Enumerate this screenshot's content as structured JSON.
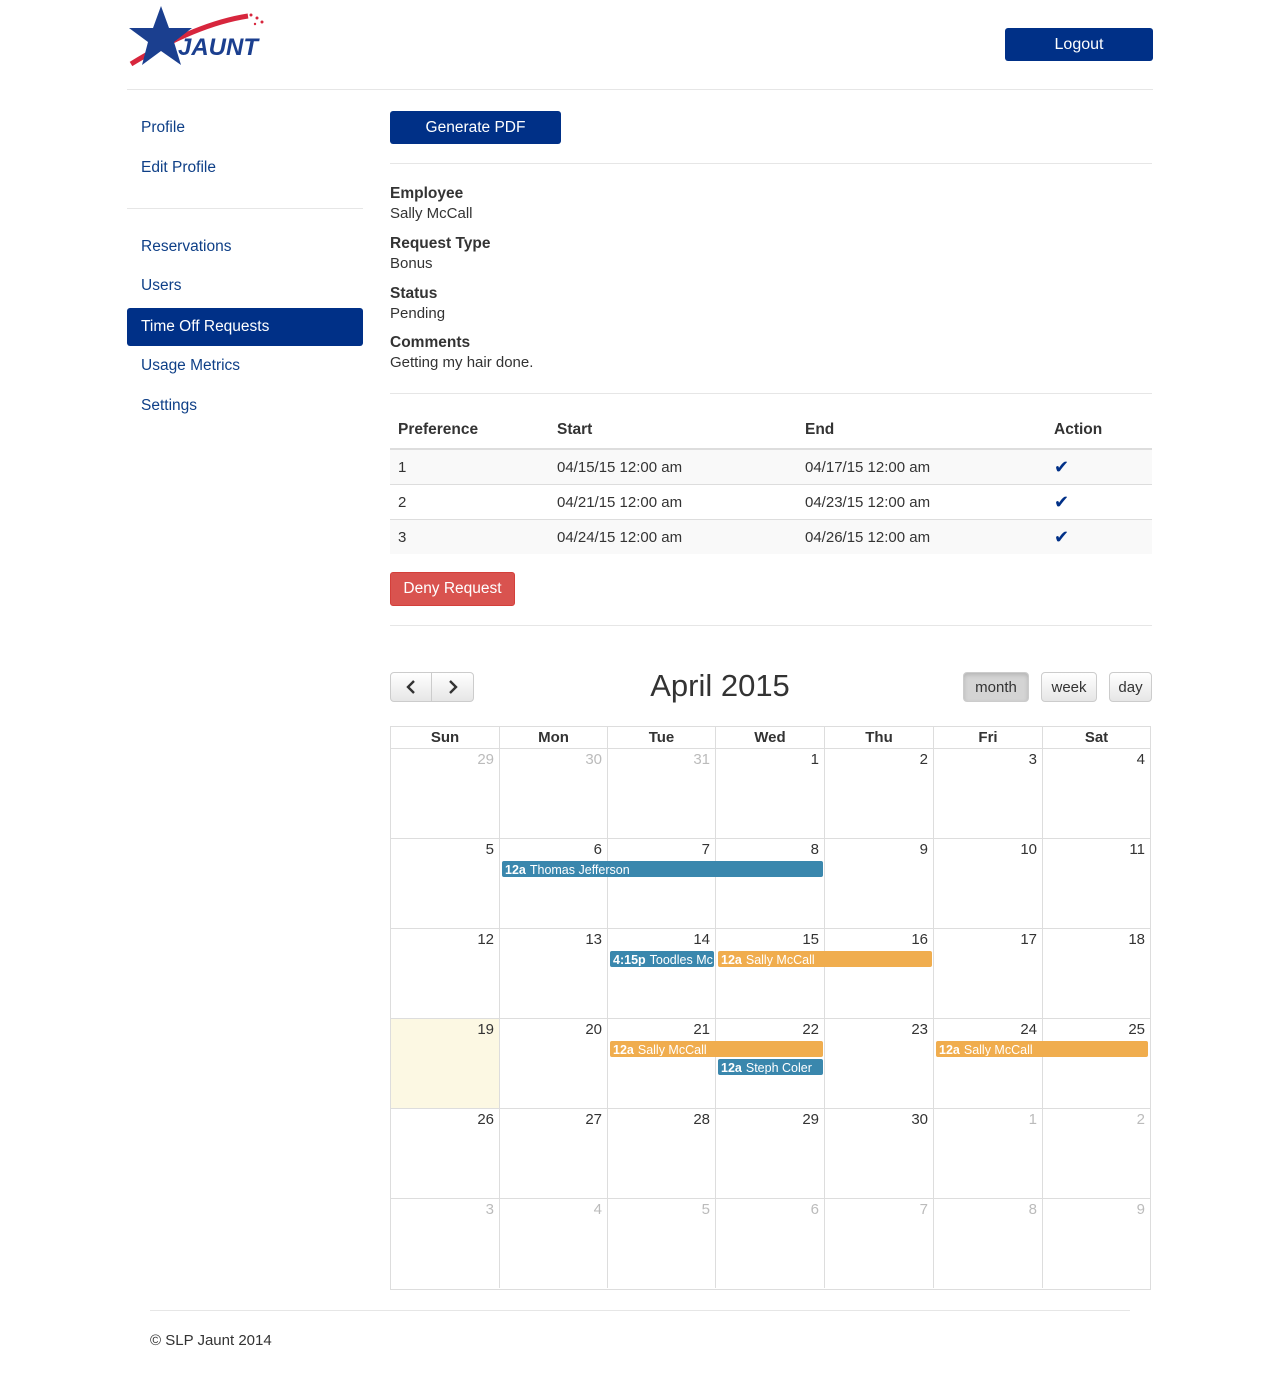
{
  "header": {
    "logo_text": "JAUNT",
    "logout_label": "Logout"
  },
  "colors": {
    "brand": "#003087",
    "danger": "#d9534f",
    "event_blue": "#3a87ad",
    "event_orange": "#f0ad4e",
    "today": "#fcf8e3"
  },
  "sidebar": {
    "group1": [
      "Profile",
      "Edit Profile"
    ],
    "group2": [
      "Reservations",
      "Users",
      "Time Off Requests",
      "Usage Metrics",
      "Settings"
    ],
    "active": "Time Off Requests"
  },
  "main": {
    "generate_pdf_label": "Generate PDF",
    "fields": [
      {
        "label": "Employee",
        "value": "Sally McCall"
      },
      {
        "label": "Request Type",
        "value": "Bonus"
      },
      {
        "label": "Status",
        "value": "Pending"
      },
      {
        "label": "Comments",
        "value": "Getting my hair done."
      }
    ],
    "table": {
      "headers": [
        "Preference",
        "Start",
        "End",
        "Action"
      ],
      "rows": [
        [
          "1",
          "04/15/15 12:00 am",
          "04/17/15 12:00 am",
          "check-icon"
        ],
        [
          "2",
          "04/21/15 12:00 am",
          "04/23/15 12:00 am",
          "check-icon"
        ],
        [
          "3",
          "04/24/15 12:00 am",
          "04/26/15 12:00 am",
          "check-icon"
        ]
      ]
    },
    "deny_label": "Deny Request"
  },
  "calendar": {
    "title": "April 2015",
    "prev_icon": "chevron-left-icon",
    "next_icon": "chevron-right-icon",
    "views": [
      "month",
      "week",
      "day"
    ],
    "active_view": "month",
    "weekdays": [
      "Sun",
      "Mon",
      "Tue",
      "Wed",
      "Thu",
      "Fri",
      "Sat"
    ],
    "weeks": [
      [
        {
          "d": "29",
          "o": true
        },
        {
          "d": "30",
          "o": true
        },
        {
          "d": "31",
          "o": true
        },
        {
          "d": "1"
        },
        {
          "d": "2"
        },
        {
          "d": "3"
        },
        {
          "d": "4"
        }
      ],
      [
        {
          "d": "5"
        },
        {
          "d": "6"
        },
        {
          "d": "7"
        },
        {
          "d": "8"
        },
        {
          "d": "9"
        },
        {
          "d": "10"
        },
        {
          "d": "11"
        }
      ],
      [
        {
          "d": "12"
        },
        {
          "d": "13"
        },
        {
          "d": "14"
        },
        {
          "d": "15"
        },
        {
          "d": "16"
        },
        {
          "d": "17"
        },
        {
          "d": "18"
        }
      ],
      [
        {
          "d": "19",
          "today": true
        },
        {
          "d": "20"
        },
        {
          "d": "21"
        },
        {
          "d": "22"
        },
        {
          "d": "23"
        },
        {
          "d": "24"
        },
        {
          "d": "25"
        }
      ],
      [
        {
          "d": "26"
        },
        {
          "d": "27"
        },
        {
          "d": "28"
        },
        {
          "d": "29"
        },
        {
          "d": "30"
        },
        {
          "d": "1",
          "o": true
        },
        {
          "d": "2",
          "o": true
        }
      ],
      [
        {
          "d": "3",
          "o": true
        },
        {
          "d": "4",
          "o": true
        },
        {
          "d": "5",
          "o": true
        },
        {
          "d": "6",
          "o": true
        },
        {
          "d": "7",
          "o": true
        },
        {
          "d": "8",
          "o": true
        },
        {
          "d": "9",
          "o": true
        }
      ]
    ],
    "events": [
      {
        "week": 1,
        "start": 1,
        "end": 3,
        "row": 0,
        "time": "12a",
        "title": "Thomas Jefferson",
        "color": "blue"
      },
      {
        "week": 2,
        "start": 2,
        "end": 2,
        "row": 0,
        "time": "4:15p",
        "title": "Toodles McGee",
        "color": "blue"
      },
      {
        "week": 2,
        "start": 3,
        "end": 4,
        "row": 0,
        "time": "12a",
        "title": "Sally McCall",
        "color": "orange"
      },
      {
        "week": 3,
        "start": 2,
        "end": 3,
        "row": 0,
        "time": "12a",
        "title": "Sally McCall",
        "color": "orange"
      },
      {
        "week": 3,
        "start": 3,
        "end": 3,
        "row": 1,
        "time": "12a",
        "title": "Steph Coler",
        "color": "blue"
      },
      {
        "week": 3,
        "start": 5,
        "end": 6,
        "row": 0,
        "time": "12a",
        "title": "Sally McCall",
        "color": "orange"
      }
    ]
  },
  "footer": {
    "text": "© SLP Jaunt 2014"
  }
}
